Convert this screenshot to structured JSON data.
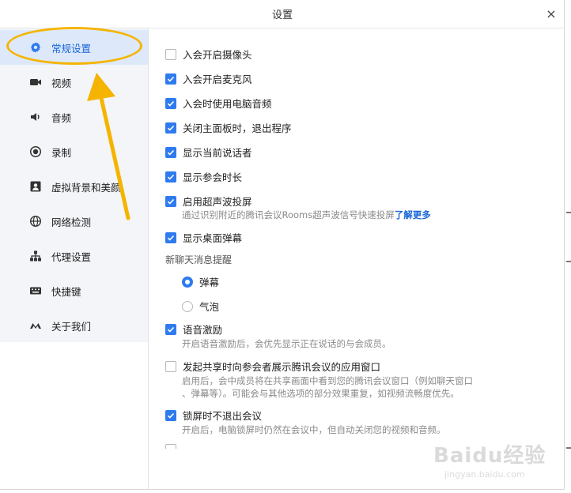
{
  "window": {
    "title": "设置",
    "close_glyph": "×"
  },
  "sidebar": {
    "items": [
      {
        "label": "常规设置",
        "icon": "gear-icon",
        "active": true
      },
      {
        "label": "视频",
        "icon": "video-camera-icon"
      },
      {
        "label": "音频",
        "icon": "speaker-icon"
      },
      {
        "label": "录制",
        "icon": "record-icon"
      },
      {
        "label": "虚拟背景和美颜",
        "icon": "portrait-icon"
      },
      {
        "label": "网络检测",
        "icon": "globe-icon"
      },
      {
        "label": "代理设置",
        "icon": "network-tree-icon"
      },
      {
        "label": "快捷键",
        "icon": "keyboard-icon"
      },
      {
        "label": "关于我们",
        "icon": "tencent-meeting-logo-icon"
      }
    ]
  },
  "settings": {
    "camera_on_join": {
      "label": "入会开启摄像头",
      "checked": false
    },
    "mic_on_join": {
      "label": "入会开启麦克风",
      "checked": true
    },
    "pc_audio_on_join": {
      "label": "入会时使用电脑音频",
      "checked": true
    },
    "exit_on_close": {
      "label": "关闭主面板时，退出程序",
      "checked": true
    },
    "show_speaker": {
      "label": "显示当前说话者",
      "checked": true
    },
    "show_duration": {
      "label": "显示参会时长",
      "checked": true
    },
    "ultrasonic_cast": {
      "label": "启用超声波投屏",
      "checked": true,
      "desc": "通过识别附近的腾讯会议Rooms超声波信号快速投屏",
      "link": "了解更多"
    },
    "desktop_danmaku": {
      "label": "显示桌面弹幕",
      "checked": true
    },
    "chat_alert": {
      "section_label": "新聊天消息提醒",
      "options": [
        {
          "label": "弹幕",
          "selected": true
        },
        {
          "label": "气泡",
          "selected": false
        }
      ]
    },
    "voice_motivation": {
      "label": "语音激励",
      "checked": true,
      "desc": "开启语音激励后，会优先显示正在说话的与会成员。"
    },
    "share_app_window": {
      "label": "发起共享时向参会者展示腾讯会议的应用窗口",
      "checked": false,
      "desc_line1": "启用后，会中成员将在共享画面中看到您的腾讯会议窗口（例如聊天窗口",
      "desc_line2": "、弹幕等）。可能会与其他选项的部分效果重复，如视频流畅度优先。"
    },
    "lock_keep_meeting": {
      "label": "锁屏时不退出会议",
      "checked": true,
      "desc": "开启后，电脑锁屏时仍然在会议中，但自动关闭您的视频和音频。"
    }
  },
  "annotation": {
    "highlight_color": "#f5b400"
  },
  "watermark": {
    "logo": "Baidu经验",
    "url": "jingyan.baidu.com"
  },
  "colors": {
    "accent": "#2e7bef",
    "active_bg": "#dde9fb",
    "sidebar_bg": "#f3f5f8"
  }
}
